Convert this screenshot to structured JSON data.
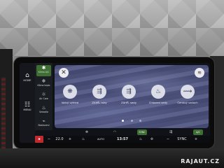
{
  "rail": {
    "home": {
      "icon": "⌂",
      "label": "HOME"
    },
    "menu": {
      "icon": "☷",
      "label": "MENU"
    }
  },
  "shortcuts": [
    {
      "icon": "✱",
      "label": "Klima A/C",
      "active": true
    },
    {
      "icon": "❄",
      "label": "Klima teplo",
      "active": false
    },
    {
      "icon": "☼",
      "label": "Air Care",
      "active": false
    },
    {
      "icon": "♨",
      "label": "Sedadla",
      "active": false
    },
    {
      "icon": "⌁",
      "label": "Nastavení",
      "active": false
    }
  ],
  "panel": {
    "close_icon": "✕",
    "heat_icon": "≋",
    "functions": [
      {
        "icon": "❋",
        "label": "Volný výhled"
      },
      {
        "icon": "⇶",
        "label": "ZAHŘ. ruky"
      },
      {
        "icon": "⇶",
        "label": "ZAHŘ. sedy"
      },
      {
        "icon": "♨",
        "label": "Chlazení sedy"
      },
      {
        "icon": "⟿",
        "label": "Čerstvý vzduch"
      }
    ],
    "page_dots": 3,
    "active_dot": 0
  },
  "toggles": [
    {
      "icon": "❄",
      "label": "",
      "green": false
    },
    {
      "icon": "◠",
      "label": "",
      "green": false
    },
    {
      "icon": "",
      "label": "SYNC",
      "green": true
    },
    {
      "icon": "⇶",
      "label": "",
      "green": false
    },
    {
      "icon": "",
      "label": "A/C",
      "green": true
    }
  ],
  "climate": {
    "fan_left": "✱",
    "minus_left": "−",
    "temp_left": "22.0",
    "plus_left": "+",
    "seat_left": "♨",
    "fan_mode": "AUTO",
    "time": "13:57",
    "seat_right": "♨",
    "fan_right": "✢",
    "minus_right": "−",
    "sync_label": "SYNC",
    "plus_right": "+"
  },
  "watermark": "RAJAUT.CZ",
  "colors": {
    "accent_green": "#3f6e35",
    "accent_red": "#c0292d",
    "panel": "#4d5280"
  }
}
